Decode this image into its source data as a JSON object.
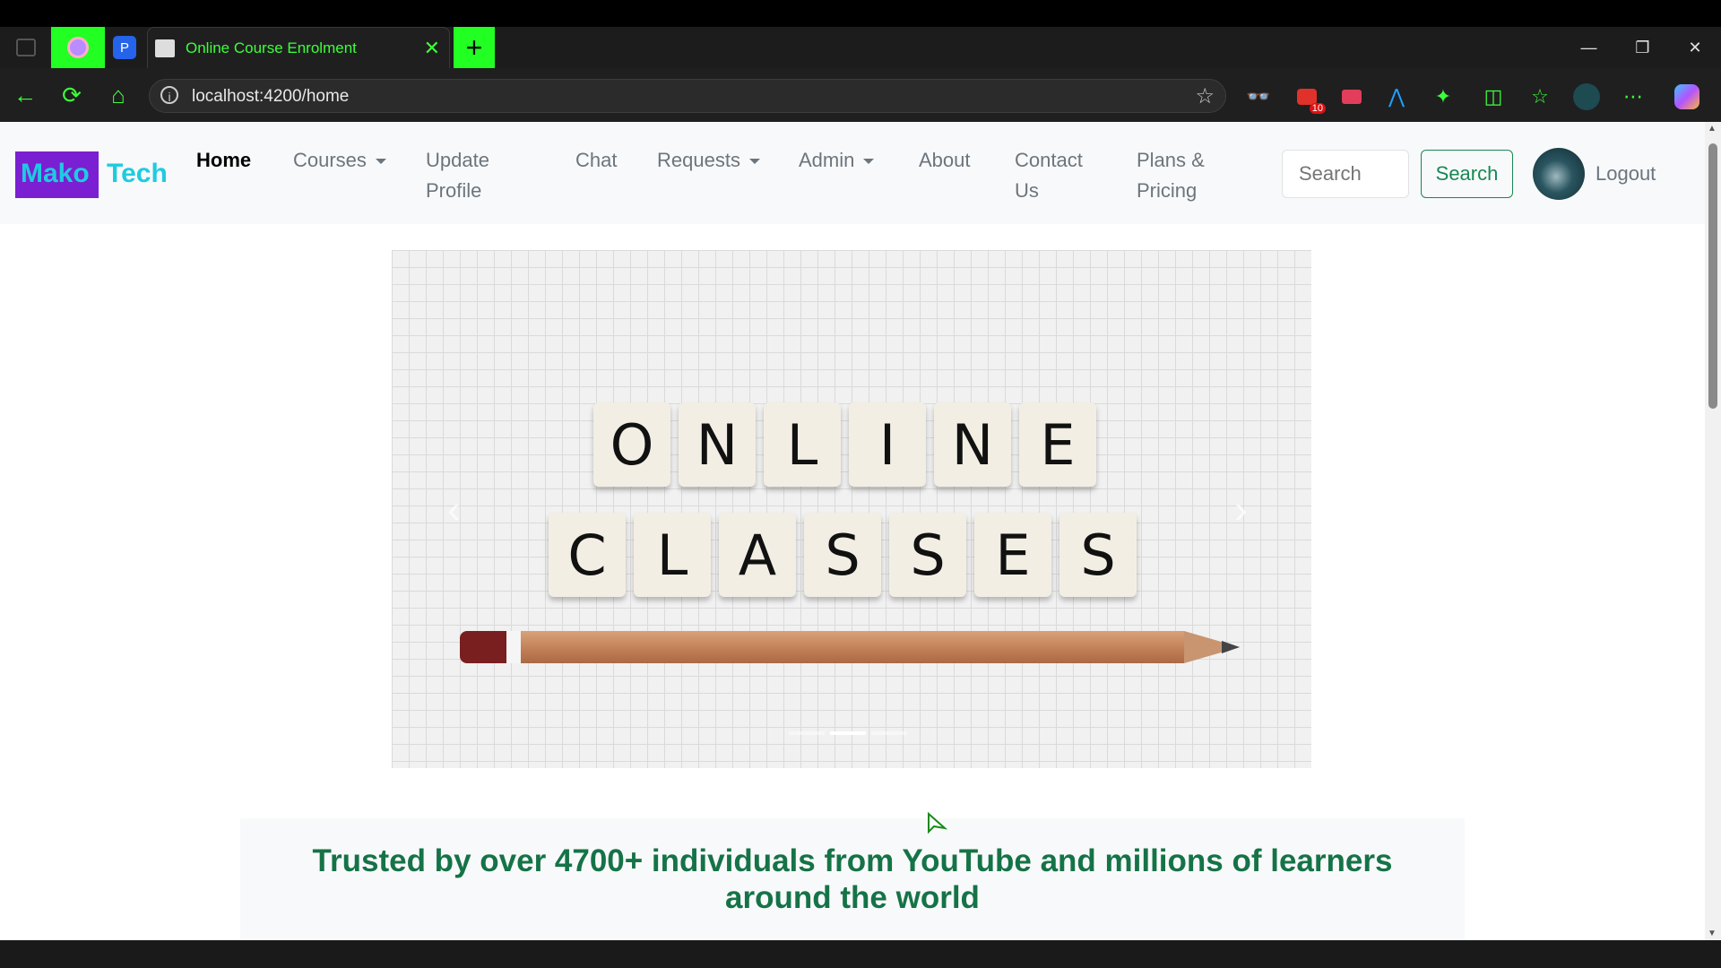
{
  "browser": {
    "tab_title": "Online Course Enrolment",
    "new_tab_symbol": "+",
    "address": "localhost:4200/home",
    "extension_badge": "10",
    "profile_tab_letter": "P"
  },
  "site": {
    "brand_left": "Mako",
    "brand_right": "Tech",
    "nav": {
      "home": "Home",
      "courses": "Courses",
      "update_profile_1": "Update",
      "update_profile_2": "Profile",
      "chat": "Chat",
      "requests": "Requests",
      "admin": "Admin",
      "about": "About",
      "contact_1": "Contact",
      "contact_2": "Us",
      "plans_1": "Plans &",
      "plans_2": "Pricing"
    },
    "search_placeholder": "Search",
    "search_button": "Search",
    "logout": "Logout",
    "hero_line1": [
      "O",
      "N",
      "L",
      "I",
      "N",
      "E"
    ],
    "hero_line2": [
      "C",
      "L",
      "A",
      "S",
      "S",
      "E",
      "S"
    ],
    "carousel_active_index": 1,
    "carousel_indicator_count": 3,
    "tagline": "Trusted by over 4700+ individuals from YouTube and millions of learners around the world"
  },
  "colors": {
    "accent_green": "#3cff3c",
    "brand_purple": "#7a1fd1",
    "brand_cyan": "#1ecbe1",
    "tagline_green": "#157347"
  }
}
